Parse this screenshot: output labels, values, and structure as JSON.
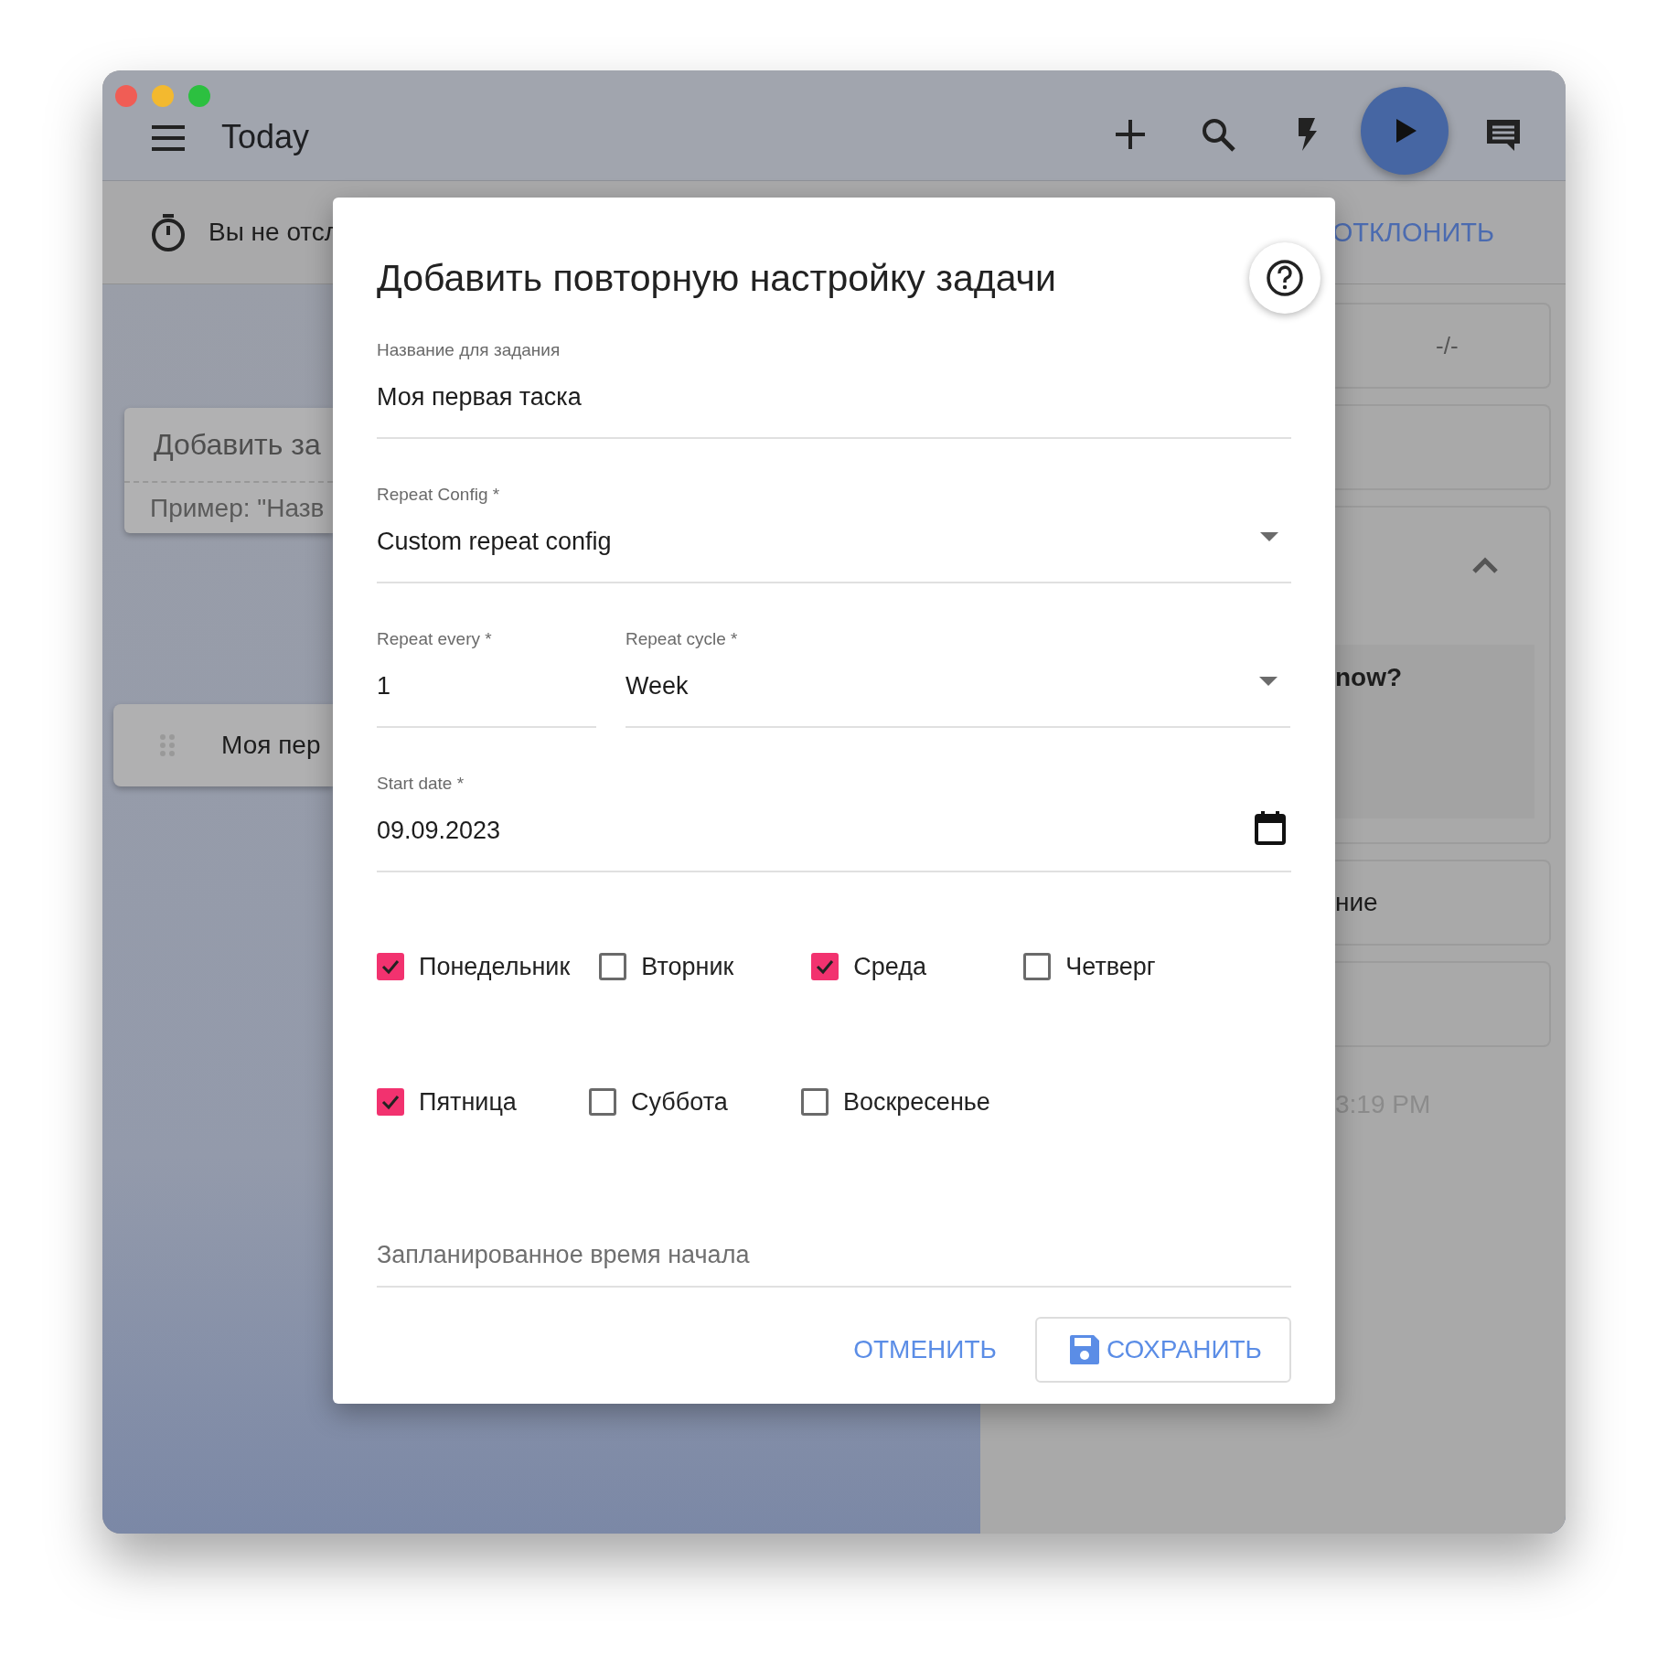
{
  "toolbar": {
    "title": "Today"
  },
  "banner": {
    "text": "Вы не отсл",
    "action": "ОТКЛОНИТЬ"
  },
  "add_task": {
    "title": "Добавить за",
    "hint": "Пример: \"Назв"
  },
  "task": {
    "title": "Моя пер"
  },
  "right_panel": {
    "value": "-/-",
    "expanded": true,
    "question": "now?",
    "item": "ние",
    "time": "3:19 PM"
  },
  "dialog": {
    "title": "Добавить повторную настройку задачи",
    "fields": [
      {
        "kind": "text",
        "label": "Название для задания",
        "value": "Моя первая таска"
      },
      {
        "kind": "select",
        "label": "Repeat Config *",
        "value": "Custom repeat config"
      }
    ],
    "repeat_every": {
      "label": "Repeat every *",
      "value": "1"
    },
    "repeat_cycle": {
      "label": "Repeat cycle *",
      "value": "Week"
    },
    "start_date": {
      "label": "Start date *",
      "value": "09.09.2023"
    },
    "weekdays": [
      {
        "label": "Понедельник",
        "checked": true
      },
      {
        "label": "Вторник",
        "checked": false
      },
      {
        "label": "Среда",
        "checked": true
      },
      {
        "label": "Четверг",
        "checked": false
      },
      {
        "label": "Пятница",
        "checked": true
      },
      {
        "label": "Суббота",
        "checked": false
      },
      {
        "label": "Воскресенье",
        "checked": false
      }
    ],
    "start_time": {
      "placeholder": "Запланированное время начала"
    },
    "cancel": "ОТМЕНИТЬ",
    "save": "СОХРАНИТЬ"
  }
}
